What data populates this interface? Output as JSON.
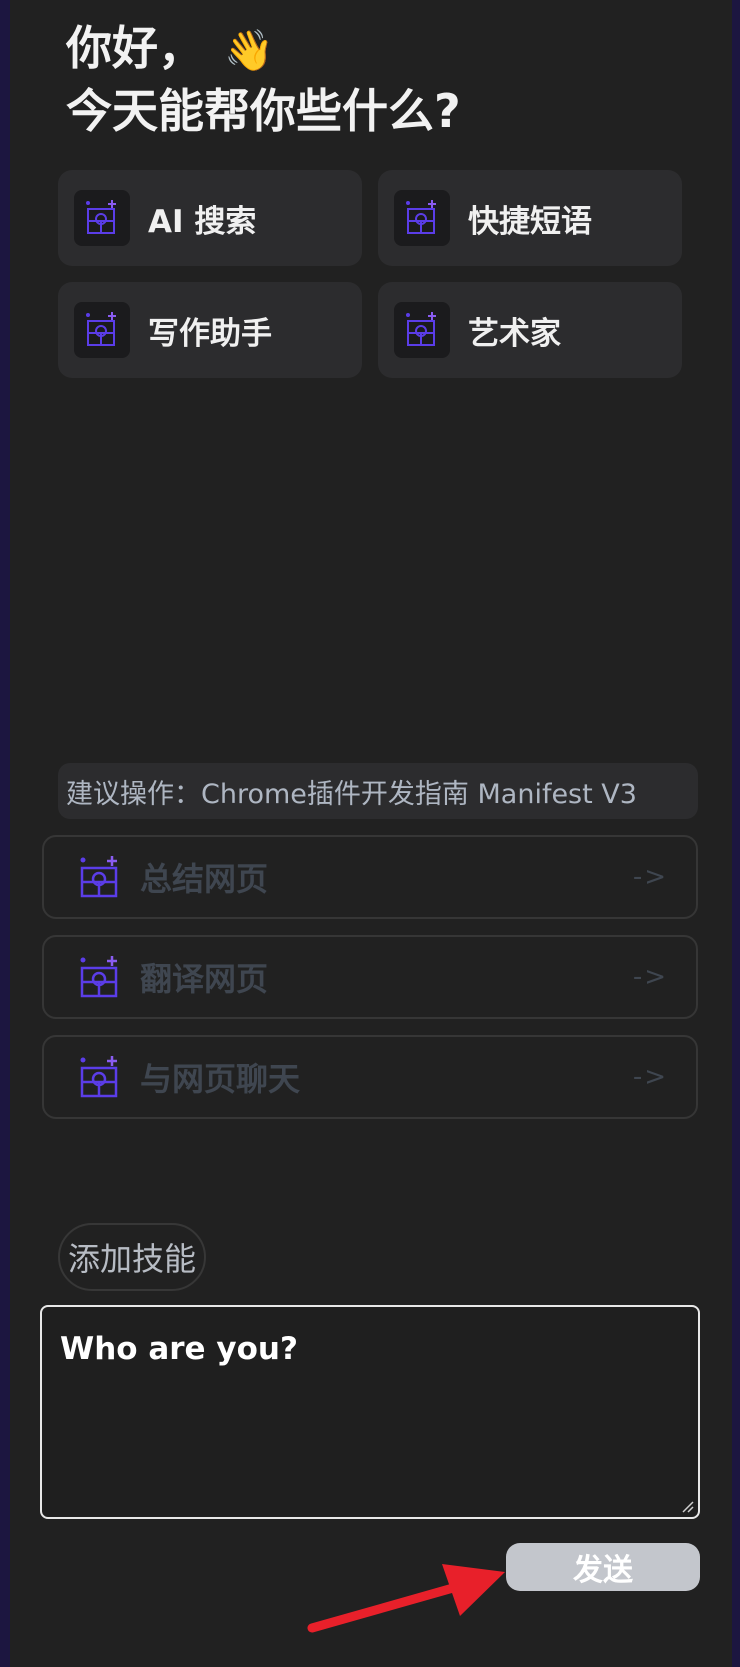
{
  "greeting": {
    "line1": "你好，",
    "wave_emoji": "👋",
    "line2": "今天能帮你些什么?"
  },
  "quick_actions": [
    {
      "label": "AI 搜索",
      "icon": "app-logo-icon"
    },
    {
      "label": "快捷短语",
      "icon": "app-logo-icon"
    },
    {
      "label": "写作助手",
      "icon": "app-logo-icon"
    },
    {
      "label": "艺术家",
      "icon": "app-logo-icon"
    }
  ],
  "suggestion": {
    "text": "建议操作：Chrome插件开发指南 Manifest V3"
  },
  "page_actions": [
    {
      "label": "总结网页",
      "arrow": "->"
    },
    {
      "label": "翻译网页",
      "arrow": "->"
    },
    {
      "label": "与网页聊天",
      "arrow": "->"
    }
  ],
  "add_skill": {
    "label": "添加技能"
  },
  "input": {
    "value": "Who are you?"
  },
  "send": {
    "label": "发送"
  },
  "colors": {
    "panel_bg": "#212121",
    "accent": "#6a3df0",
    "annotation_arrow": "#e8202a"
  }
}
